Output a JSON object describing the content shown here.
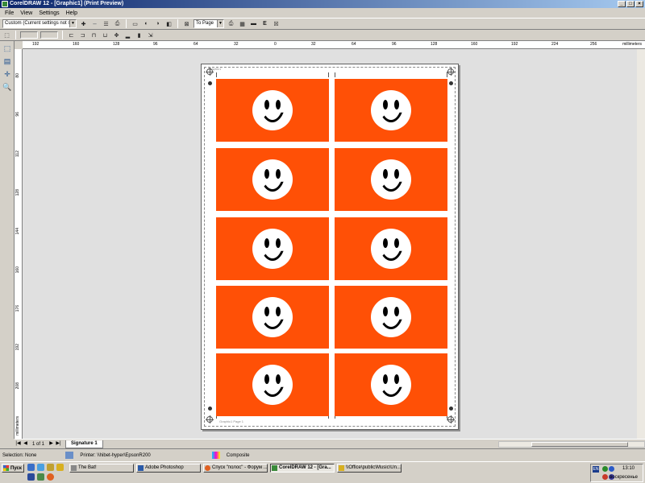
{
  "window": {
    "title": "CorelDRAW 12 - [Graphic1] (Print Preview)",
    "controls": [
      "_",
      "□",
      "×"
    ]
  },
  "menu": [
    {
      "label": "File",
      "mnemonic": "F"
    },
    {
      "label": "View",
      "mnemonic": "V"
    },
    {
      "label": "Settings",
      "mnemonic": "S"
    },
    {
      "label": "Help",
      "mnemonic": "H"
    }
  ],
  "toolbar": {
    "preset_value": "Custom (Current settings not s...",
    "zoom_value": "To Page",
    "help_label": "E"
  },
  "ruler": {
    "unit": "millimeters",
    "h_labels": [
      "192",
      "160",
      "128",
      "96",
      "64",
      "32",
      "0",
      "32",
      "64",
      "96",
      "128",
      "160",
      "192",
      "224",
      "256"
    ],
    "v_labels": [
      "80",
      "96",
      "112",
      "128",
      "144",
      "160",
      "176",
      "192",
      "208",
      "224",
      "240",
      "256",
      "272",
      "288",
      "304"
    ]
  },
  "page_labels": {
    "top": "Graphic1",
    "bottom": "Graphic1 Page 1"
  },
  "cards": {
    "rows": 5,
    "cols": 2,
    "color": "#ff5006",
    "motif": "smiley-face"
  },
  "nav": {
    "page_count": "1 of 1",
    "signature_tab": "Signature 1"
  },
  "status": {
    "selection": "Selection: None",
    "printer": "Printer: \\\\hibet-hyper\\EpsonR200",
    "mode": "Composite"
  },
  "taskbar": {
    "start": "Пуск",
    "buttons": [
      {
        "label": "The Bat!",
        "active": false
      },
      {
        "label": "Adobe Photoshop",
        "active": false
      },
      {
        "label": "Спуск \"полос\" - Форум ...",
        "active": false
      },
      {
        "label": "CorelDRAW 12 - [Gra...",
        "active": true
      },
      {
        "label": "\\\\Office\\public\\Music\\Un...",
        "active": false
      }
    ],
    "clock": "13:10",
    "weekday": "воскресенье",
    "lang": "EN"
  }
}
